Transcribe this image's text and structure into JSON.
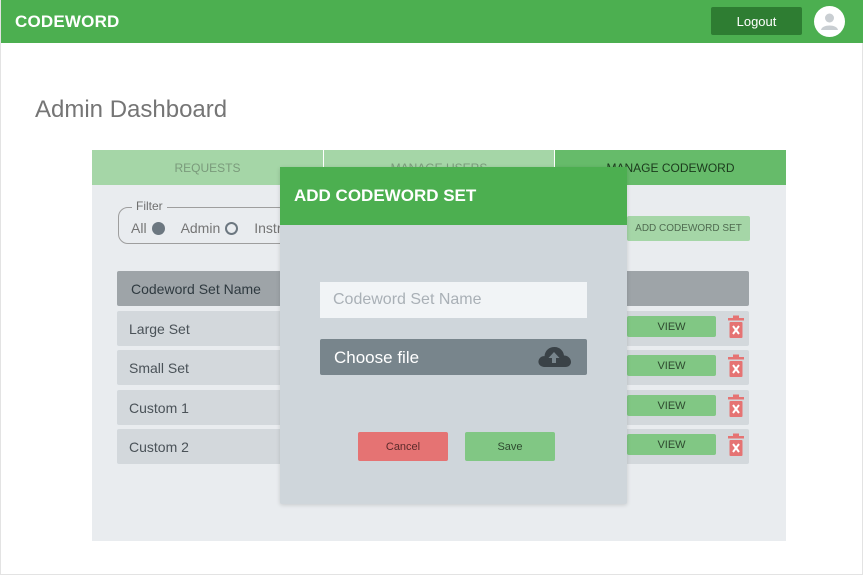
{
  "header": {
    "brand": "CODEWORD",
    "logout_label": "Logout",
    "accent_color": "#4caf50",
    "avatar_icon": "user-avatar-icon"
  },
  "page": {
    "title": "Admin Dashboard"
  },
  "tabs": [
    {
      "label": "REQUESTS"
    },
    {
      "label": "MANAGE USERS"
    },
    {
      "label": "MANAGE CODEWORD"
    }
  ],
  "filter": {
    "legend": "Filter",
    "options": [
      {
        "label": "All",
        "selected": true
      },
      {
        "label": "Admin",
        "selected": false
      },
      {
        "label": "Instructor",
        "selected": false
      }
    ]
  },
  "add_set_button": "ADD CODEWORD SET",
  "table": {
    "header": "Codeword Set Name",
    "rows": [
      {
        "name": "Large Set",
        "view_label": "VIEW"
      },
      {
        "name": "Small Set",
        "view_label": "VIEW"
      },
      {
        "name": "Custom 1",
        "view_label": "VIEW"
      },
      {
        "name": "Custom 2",
        "view_label": "VIEW"
      }
    ],
    "delete_icon": "trash-icon",
    "delete_color": "#e57373"
  },
  "modal": {
    "title": "ADD CODEWORD SET",
    "name_placeholder": "Codeword Set Name",
    "name_value": "",
    "choose_file_label": "Choose file",
    "upload_icon": "cloud-upload-icon",
    "cancel_label": "Cancel",
    "save_label": "Save"
  }
}
